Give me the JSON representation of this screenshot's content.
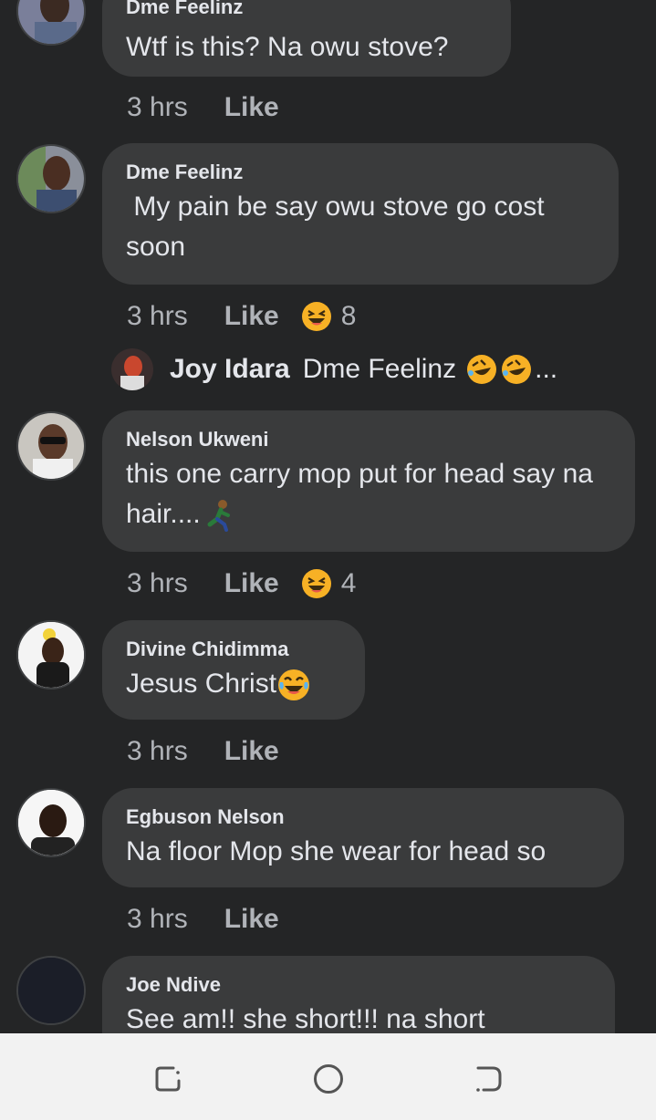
{
  "comments": [
    {
      "author": "Dme Feelinz",
      "text": "Wtf is this? Na owu stove?",
      "time": "3 hrs",
      "like": "Like"
    },
    {
      "author": "Dme Feelinz",
      "text": " My pain be say owu stove go cost soon",
      "time": "3 hrs",
      "like": "Like",
      "reaction_icon": "laughing-face-icon",
      "reaction_count": "8",
      "reply": {
        "author": "Joy Idara",
        "text": "Dme Feelinz",
        "emoji_icons": [
          "rolling-laughing-icon",
          "rolling-laughing-icon"
        ],
        "ellipsis": "..."
      }
    },
    {
      "author": "Nelson Ukweni",
      "text": "this one carry mop put for head say na hair....",
      "text_emoji": "running-man-icon",
      "time": "3 hrs",
      "like": "Like",
      "reaction_icon": "laughing-face-icon",
      "reaction_count": "4"
    },
    {
      "author": "Divine Chidimma",
      "text": "Jesus Christ",
      "text_emoji": "tears-of-joy-icon",
      "time": "3 hrs",
      "like": "Like"
    },
    {
      "author": "Egbuson Nelson",
      "text": "Na floor Mop she wear for head so",
      "time": "3 hrs",
      "like": "Like"
    },
    {
      "author": "Joe Ndive",
      "text": "See am!! she short!!! na short"
    }
  ],
  "navbar": {
    "icons": [
      "recent-apps-icon",
      "home-icon",
      "back-icon"
    ]
  },
  "colors": {
    "background": "#242526",
    "bubble": "#3a3b3c",
    "text": "#e4e6eb",
    "meta_text": "#b0b3b8",
    "navbar": "#f2f2f2"
  }
}
